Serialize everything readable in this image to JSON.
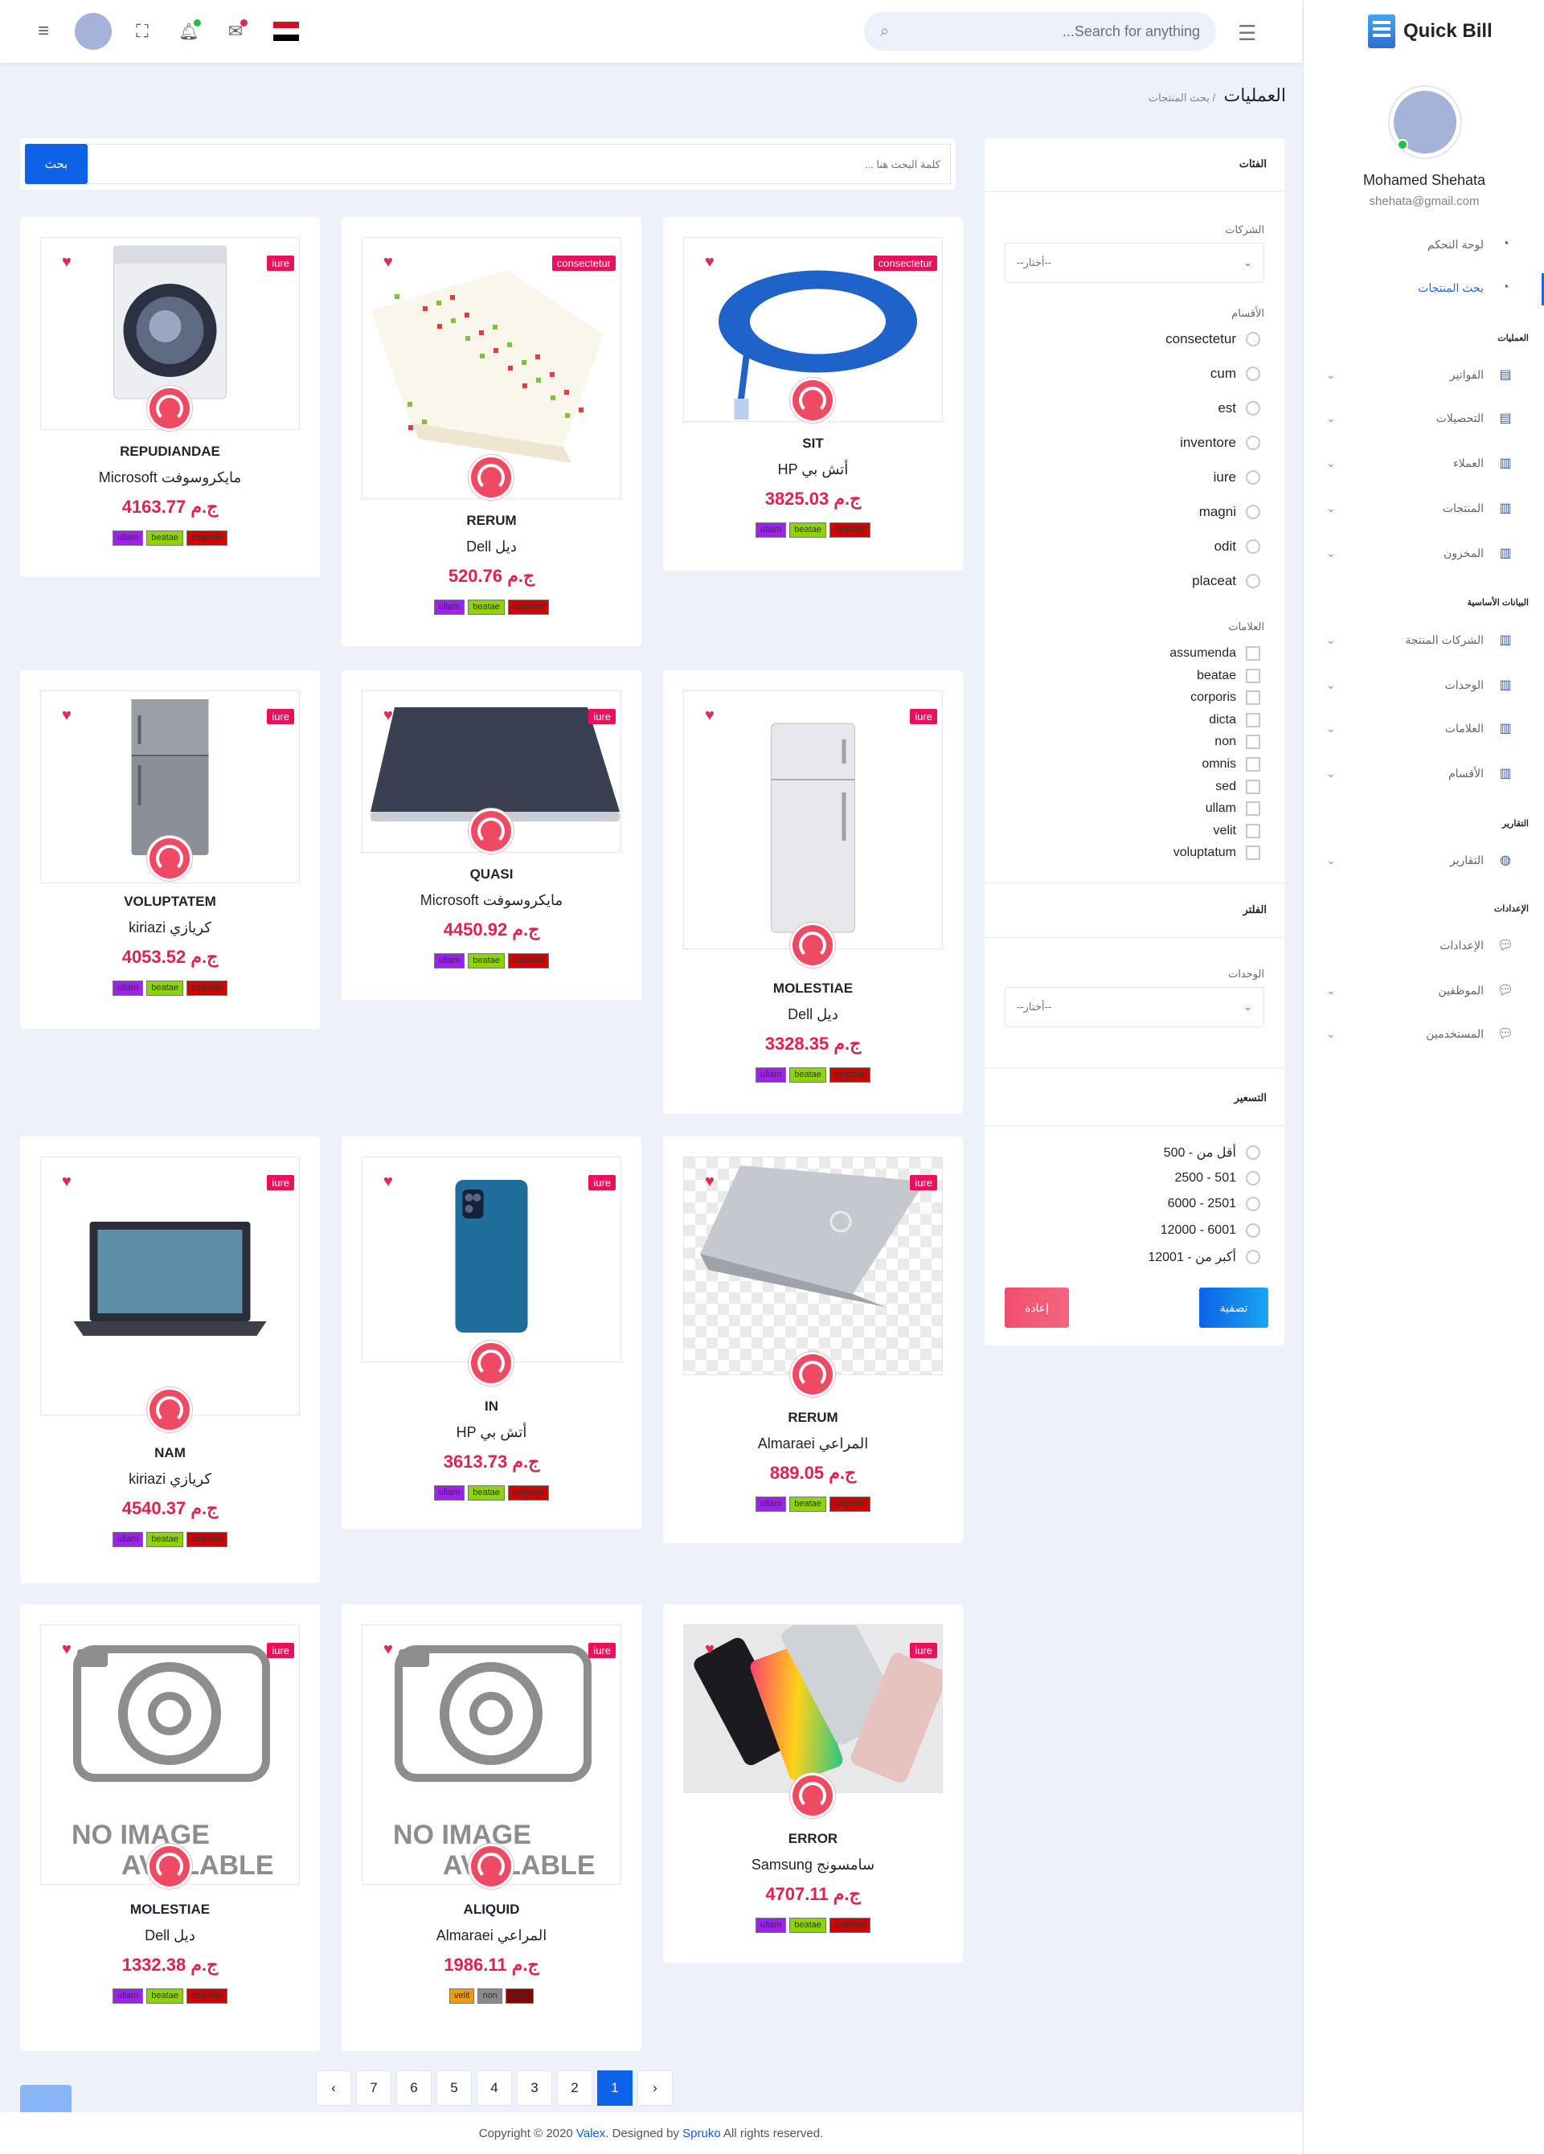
{
  "header": {
    "search_placeholder": "Search for anything...",
    "badge_colors": {
      "bell": "#22c03c",
      "mail": "#e22a4e"
    }
  },
  "sidebar": {
    "brand": "Quick Bill",
    "user_name": "Mohamed Shehata",
    "user_email": "shehata@gmail.com",
    "top_items": [
      {
        "label": "لوحة التحكم",
        "icon": "dashboard-icon"
      },
      {
        "label": "بحث المنتجات",
        "icon": "dashboard-icon",
        "active": true
      }
    ],
    "cat_operations": "العمليات",
    "operations": [
      {
        "label": "الفواتير",
        "icon": "document-icon"
      },
      {
        "label": "التحصيلات",
        "icon": "document-icon"
      },
      {
        "label": "العملاء",
        "icon": "chart-icon"
      },
      {
        "label": "المنتجات",
        "icon": "chart-icon"
      },
      {
        "label": "المخزون",
        "icon": "chart-icon"
      }
    ],
    "cat_master": "البيانات الأساسية",
    "master": [
      {
        "label": "الشركات المنتجة",
        "icon": "chart-icon"
      },
      {
        "label": "الوحدات",
        "icon": "chart-icon"
      },
      {
        "label": "العلامات",
        "icon": "chart-icon"
      },
      {
        "label": "الأقسام",
        "icon": "chart-icon"
      }
    ],
    "cat_reports": "التقارير",
    "reports": [
      {
        "label": "التقارير",
        "icon": "globe-icon"
      }
    ],
    "cat_settings": "الإعدادات",
    "settings": [
      {
        "label": "الإعدادات",
        "icon": "chat-icon"
      },
      {
        "label": "الموظفين",
        "icon": "chat-icon"
      },
      {
        "label": "المستخدمين",
        "icon": "chat-icon"
      }
    ]
  },
  "breadcrumb": {
    "title": "العمليات",
    "sub": "/ بحث المنتجات"
  },
  "main_search": {
    "placeholder": "كلمة البحث هنا ...",
    "button": "بحث"
  },
  "filter": {
    "categories_title": "الفئات",
    "companies_label": "الشركات",
    "select_placeholder": "--أختار--",
    "sections_label": "الأقسام",
    "sections": [
      "consectetur",
      "cum",
      "est",
      "inventore",
      "iure",
      "magni",
      "odit",
      "placeat"
    ],
    "tags_label": "العلامات",
    "tags": [
      "assumenda",
      "beatae",
      "corporis",
      "dicta",
      "non",
      "omnis",
      "sed",
      "ullam",
      "velit",
      "voluptatum"
    ],
    "filter_title": "الفلتر",
    "units_label": "الوحدات",
    "pricing_title": "التسعير",
    "price_ranges": [
      "أقل من - 500",
      "501 - 2500",
      "2501 - 6000",
      "6001 - 12000",
      "أكبر من - 12001"
    ],
    "apply_button": "تصفية",
    "reset_button": "إعادة"
  },
  "products": [
    {
      "name": "REPUDIANDAE",
      "brand": "Microsoft مايكروسوفت",
      "price": "4163.77 ج.م",
      "tag": "iure",
      "image": "washer",
      "tags": [
        "ullam",
        "beatae",
        "corporis"
      ]
    },
    {
      "name": "RERUM",
      "brand": "Dell ديل",
      "price": "520.76 ج.م",
      "tag": "consectetur",
      "image": "cheese",
      "tags": [
        "ullam",
        "beatae",
        "corporis"
      ]
    },
    {
      "name": "SIT",
      "brand": "HP أتش بي",
      "price": "3825.03 ج.م",
      "tag": "consectetur",
      "image": "cable",
      "tags": [
        "ullam",
        "beatae",
        "corporis"
      ]
    },
    {
      "name": "VOLUPTATEM",
      "brand": "kiriazi كريازي",
      "price": "4053.52 ج.م",
      "tag": "iure",
      "image": "fridge-dark",
      "tags": [
        "ullam",
        "beatae",
        "corporis"
      ]
    },
    {
      "name": "QUASI",
      "brand": "Microsoft مايكروسوفت",
      "price": "4450.92 ج.م",
      "tag": "iure",
      "image": "laptop-closed",
      "tags": [
        "ullam",
        "beatae",
        "corporis"
      ]
    },
    {
      "name": "MOLESTIAE",
      "brand": "Dell ديل",
      "price": "3328.35 ج.م",
      "tag": "iure",
      "image": "fridge-white",
      "tags": [
        "ullam",
        "beatae",
        "corporis"
      ]
    },
    {
      "name": "NAM",
      "brand": "kiriazi كريازي",
      "price": "4540.37 ج.م",
      "tag": "iure",
      "image": "laptop-open",
      "tags": [
        "ullam",
        "beatae",
        "corporis"
      ]
    },
    {
      "name": "IN",
      "brand": "HP أتش بي",
      "price": "3613.73 ج.م",
      "tag": "iure",
      "image": "phone",
      "tags": [
        "ullam",
        "beatae",
        "corporis"
      ]
    },
    {
      "name": "RERUM",
      "brand": "Almaraei المراعي",
      "price": "889.05 ج.م",
      "tag": "iure",
      "image": "laptop-silver",
      "tags": [
        "ullam",
        "beatae",
        "corporis"
      ]
    },
    {
      "name": "MOLESTIAE",
      "brand": "Dell ديل",
      "price": "1332.38 ج.م",
      "tag": "iure",
      "image": "no-image",
      "tags": [
        "ullam",
        "beatae",
        "corporis"
      ]
    },
    {
      "name": "ALIQUID",
      "brand": "Almaraei المراعي",
      "price": "1986.11 ج.م",
      "tag": "iure",
      "image": "no-image",
      "tags": [
        "velit",
        "non",
        "dicta"
      ]
    },
    {
      "name": "ERROR",
      "brand": "Samsung سامسونج",
      "price": "4707.11 ج.م",
      "tag": "iure",
      "image": "phones",
      "tags": [
        "ullam",
        "beatae",
        "corporis"
      ]
    }
  ],
  "no_image_text": {
    "line1": "NO IMAGE",
    "line2": "AVAILABLE"
  },
  "tag_colors": {
    "ullam": "#a020f0",
    "beatae": "#8fd400",
    "corporis": "#d40000",
    "velit": "#f29b0a",
    "non": "#8a8a8a",
    "dicta": "#8b0000"
  },
  "pagination": [
    "‹",
    "7",
    "6",
    "5",
    "4",
    "3",
    "2",
    "1",
    "›"
  ],
  "pagination_current": "1",
  "footer": {
    "pre": "Copyright © 2020 ",
    "brand1": "Valex",
    "mid": ". Designed by ",
    "brand2": "Spruko",
    "post": " All rights reserved."
  }
}
